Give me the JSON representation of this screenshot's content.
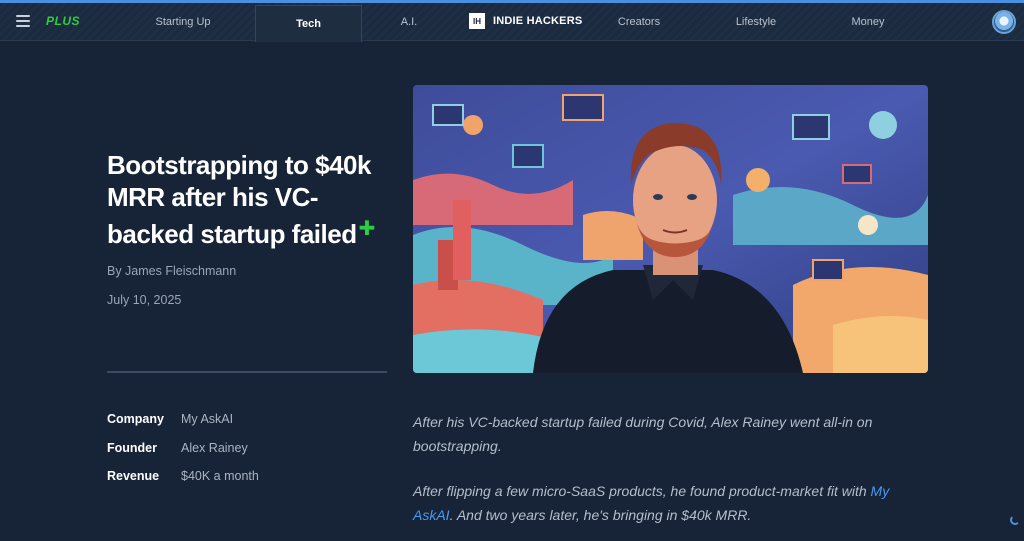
{
  "nav": {
    "brand": "PLUS",
    "tabs": [
      "Starting Up",
      "Tech",
      "A.I.",
      "Creators",
      "Lifestyle",
      "Money"
    ],
    "active_tab": "Tech",
    "logo_mark": "IH",
    "logo_text": "INDIE HACKERS"
  },
  "article": {
    "title": "Bootstrapping to $40k MRR after his VC-backed startup failed",
    "title_badge": "✚",
    "byline": "By James Fleischmann",
    "date": "July 10, 2025",
    "facts": [
      {
        "label": "Company",
        "value": "My AskAI"
      },
      {
        "label": "Founder",
        "value": "Alex Rainey"
      },
      {
        "label": "Revenue",
        "value": "$40K a month"
      }
    ],
    "para1": "After his VC-backed startup failed during Covid, Alex Rainey went all-in on bootstrapping.",
    "para2_before": "After flipping a few micro-SaaS products, he found product-market fit with ",
    "para2_link": "My AskAI",
    "para2_after": ". And two years later, he's bringing in $40k MRR."
  },
  "colors": {
    "background": "#172336",
    "accent": "#4a90e2",
    "plus_green": "#2ecc40",
    "link": "#4a9cf0"
  },
  "icons": {
    "menu": "hamburger-icon",
    "account": "avatar-icon",
    "loading": "spinner-icon"
  }
}
